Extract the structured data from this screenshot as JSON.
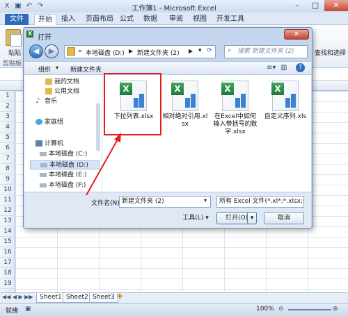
{
  "app": {
    "title": "工作簿1 - Microsoft Excel",
    "tabs": [
      "文件",
      "开始",
      "插入",
      "页面布局",
      "公式",
      "数据",
      "审阅",
      "视图",
      "开发工具"
    ],
    "ribbon_left_label": "粘贴",
    "ribbon_left_group": "剪贴板",
    "ribbon_right_label": "查找和选择"
  },
  "grid": {
    "rows": [
      "1",
      "2",
      "3",
      "4",
      "5",
      "6",
      "7",
      "8",
      "9",
      "10",
      "11",
      "12",
      "13",
      "14",
      "15",
      "16",
      "17",
      "18",
      "19"
    ]
  },
  "sheets": [
    "Sheet1",
    "Sheet2",
    "Sheet3"
  ],
  "status": {
    "ready": "就绪",
    "zoom": "100%"
  },
  "dialog": {
    "title": "打开",
    "path": [
      "本地磁盘 (D:)",
      "新建文件夹 (2)"
    ],
    "search_placeholder": "搜索 新建文件夹 (2)",
    "organize": "组织",
    "new_folder": "新建文件夹",
    "nav_items": [
      {
        "label": "我的文档",
        "icon": "folder-icon"
      },
      {
        "label": "公用文档",
        "icon": "folder-icon"
      },
      {
        "label": "音乐",
        "icon": "music-icon"
      },
      {
        "label": "家庭组",
        "icon": "homegroup-icon"
      },
      {
        "label": "计算机",
        "icon": "computer-icon"
      },
      {
        "label": "本地磁盘 (C:)",
        "icon": "drive-icon"
      },
      {
        "label": "本地磁盘 (D:)",
        "icon": "drive-icon"
      },
      {
        "label": "本地磁盘 (E:)",
        "icon": "drive-icon"
      },
      {
        "label": "本地磁盘 (F:)",
        "icon": "drive-icon"
      }
    ],
    "files": [
      {
        "name": "下拉列表.xlsx",
        "icon": "excel-file-icon"
      },
      {
        "name": "相对绝对引用.xlsx",
        "icon": "excel-file-icon"
      },
      {
        "name": "在Excel中如何输入带括号的数字.xlsx",
        "icon": "excel-file-icon"
      },
      {
        "name": "自定义序列.xls",
        "icon": "excel-file-icon"
      }
    ],
    "filename_label": "文件名(N):",
    "filename_value": "新建文件夹 (2)",
    "filetype_value": "所有 Excel 文件(*.xl*;*.xlsx;*.xl",
    "tools_label": "工具(L)",
    "open_label": "打开(O)",
    "cancel_label": "取消"
  },
  "colors": {
    "accent": "#2e6bb8",
    "highlight": "#e21d1d"
  }
}
